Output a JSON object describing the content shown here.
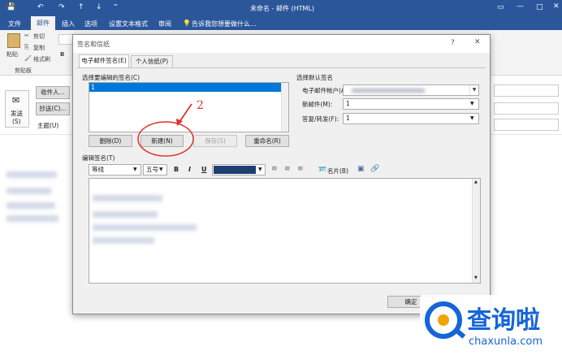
{
  "window": {
    "title": "未命名 - 邮件 (HTML)"
  },
  "ribbon": {
    "tabs": [
      "文件",
      "邮件",
      "插入",
      "选项",
      "设置文本格式",
      "审阅"
    ],
    "active_tab": "邮件",
    "tell_me": "告诉我您想要做什么...",
    "clipboard": {
      "paste": "粘贴",
      "cut": "剪切",
      "copy": "复制",
      "format_painter": "格式刷",
      "group": "剪贴板"
    }
  },
  "compose": {
    "send": "发送",
    "send_key": "(S)",
    "to": "收件人...",
    "cc": "抄送(C)...",
    "subject": "主题(U)"
  },
  "dialog": {
    "title": "签名和信纸",
    "tabs": [
      "电子邮件签名(E)",
      "个人信纸(P)"
    ],
    "select_sig_label": "选择要编辑的签名(C)",
    "sig_list": [
      "1"
    ],
    "buttons": {
      "delete": "删除(D)",
      "new": "新建(N)",
      "save": "保存(S)",
      "rename": "重命名(R)"
    },
    "default_sig": {
      "group_label": "选择默认签名",
      "account_label": "电子邮件帐户(A):",
      "new_msg_label": "新邮件(M):",
      "new_msg_value": "1",
      "reply_label": "答复/转发(F):",
      "reply_value": "1"
    },
    "edit_label": "编辑签名(T)",
    "editor": {
      "font": "等线",
      "size": "五号",
      "bold": "B",
      "italic": "I",
      "underline": "U",
      "business_card": "名片(B)",
      "text_color": "#1f3f74"
    },
    "ok": "确定"
  },
  "annotation": {
    "number": "2",
    "color": "#e0302a"
  },
  "watermark": {
    "brand": "查询啦",
    "domain": "chaxunla.com",
    "color": "#1565d8"
  }
}
